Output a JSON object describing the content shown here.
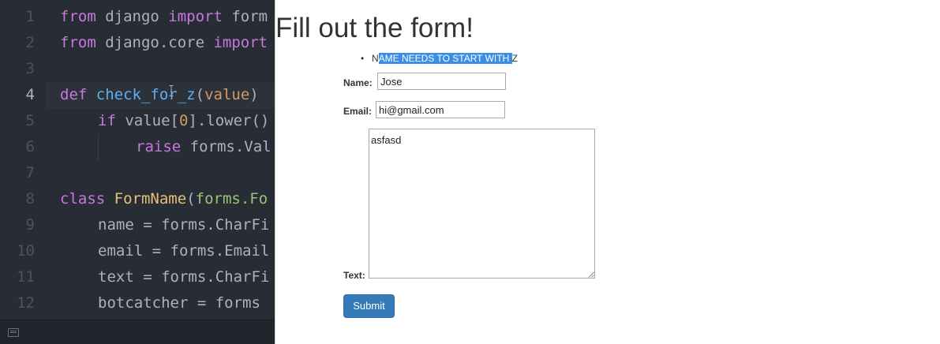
{
  "editor": {
    "line_numbers": [
      "1",
      "2",
      "3",
      "4",
      "5",
      "6",
      "7",
      "8",
      "9",
      "10",
      "11",
      "12"
    ],
    "code": {
      "line1": {
        "kw_from": "from",
        "module": " django ",
        "kw_import": "import",
        "rest": " form"
      },
      "line2": {
        "kw_from": "from",
        "module": " django.core ",
        "kw_import": "import"
      },
      "line4": {
        "kw_def": "def",
        "fn_name": "check_for_z",
        "open": "(",
        "param": "value",
        "close": ")"
      },
      "line5": {
        "kw_if": "if",
        "pre": " value[",
        "num": "0",
        "post": "].lower()"
      },
      "line6": {
        "kw_raise": "raise",
        "rest": " forms.Val"
      },
      "line8": {
        "kw_class": "class",
        "cls_name": "FormName",
        "open": "(",
        "base": "forms.Fo"
      },
      "line9": "name = forms.CharFi",
      "line10": "email = forms.Email",
      "line11": "text = forms.CharFi",
      "line12": "botcatcher = forms"
    },
    "status_icon": "keyboard-icon"
  },
  "page": {
    "title": "Fill out the form!",
    "errors": {
      "first_char": "N",
      "selected": "AME NEEDS TO START WITH ",
      "last_char": "Z"
    },
    "form": {
      "name_label": "Name:",
      "name_value": "Jose",
      "email_label": "Email:",
      "email_value": "hi@gmail.com",
      "text_label": "Text:",
      "text_value": "asfasd",
      "submit_label": "Submit"
    }
  },
  "colors": {
    "editor_bg": "#282c34",
    "keyword": "#c678dd",
    "function": "#61afef",
    "number": "#d19a66",
    "class": "#e5c07b",
    "inherited": "#98c379",
    "selection": "#3a8ee6",
    "button": "#337ab7"
  }
}
